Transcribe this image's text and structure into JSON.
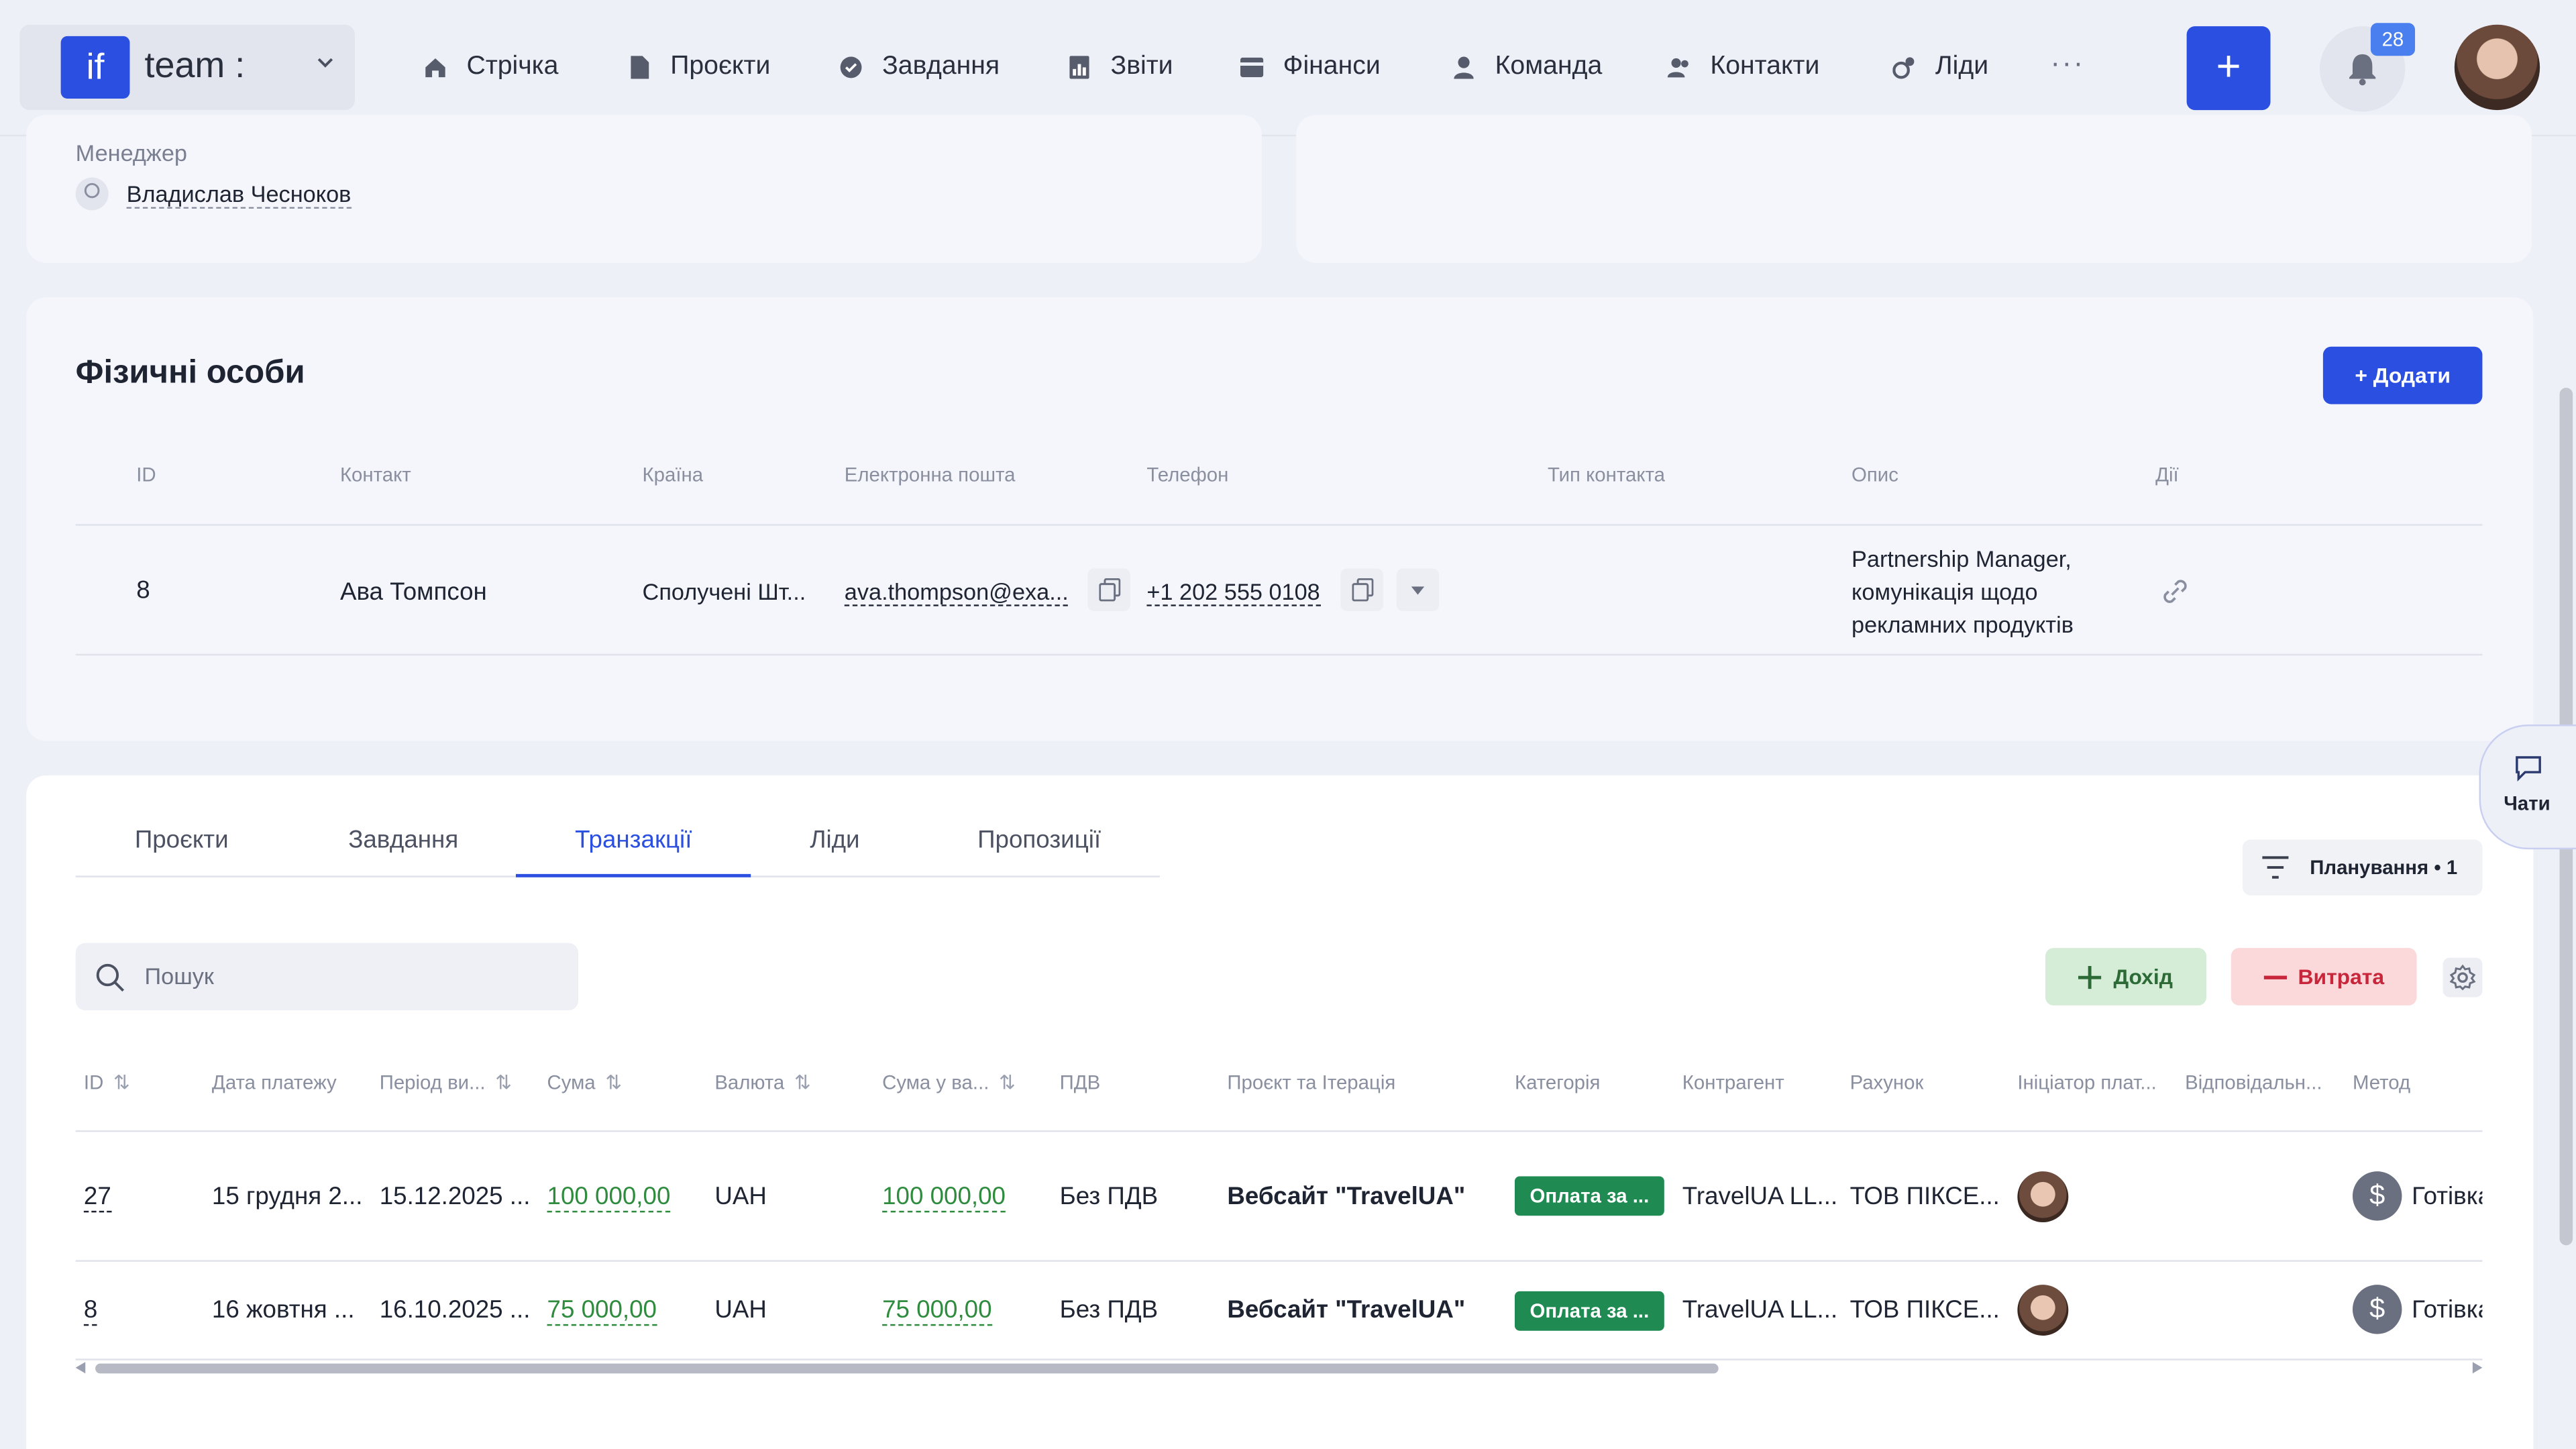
{
  "navbar": {
    "brand_logo": "if",
    "brand_name": "team :",
    "items": [
      {
        "label": "Стрічка",
        "icon": "home-icon"
      },
      {
        "label": "Проєкти",
        "icon": "document-icon"
      },
      {
        "label": "Завдання",
        "icon": "check-circle-icon"
      },
      {
        "label": "Звіти",
        "icon": "report-icon"
      },
      {
        "label": "Фінанси",
        "icon": "wallet-icon"
      },
      {
        "label": "Команда",
        "icon": "user-icon"
      },
      {
        "label": "Контакти",
        "icon": "contacts-icon"
      },
      {
        "label": "Ліди",
        "icon": "leads-icon"
      }
    ],
    "more": "···",
    "plus": "+",
    "notifications_count": "28"
  },
  "manager": {
    "label": "Менеджер",
    "name": "Владислав Чесноков"
  },
  "individuals": {
    "title": "Фізичні особи",
    "add_button": "+ Додати",
    "columns": [
      "ID",
      "Контакт",
      "Країна",
      "Електронна пошта",
      "Телефон",
      "Тип контакта",
      "Опис",
      "Дії"
    ],
    "row": {
      "id": "8",
      "contact": "Ава Томпсон",
      "country": "Сполучені Шт...",
      "email": "ava.thompson@exa...",
      "phone": "+1 202 555 0108",
      "description_lines": [
        "Partnership Manager,",
        "комунікація щодо",
        "рекламних продуктів"
      ]
    }
  },
  "tabs": [
    "Проєкти",
    "Завдання",
    "Транзакції",
    "Ліди",
    "Пропозиції"
  ],
  "active_tab": "Транзакції",
  "filter_label": "Планування • 1",
  "search_placeholder": "Пошук",
  "income_button": "Дохід",
  "expense_button": "Витрата",
  "transactions": {
    "columns": [
      "ID",
      "Дата платежу",
      "Період ви...",
      "Сума",
      "Валюта",
      "Сума у ва...",
      "ПДВ",
      "Проєкт та Ітерація",
      "Категорія",
      "Контрагент",
      "Рахунок",
      "Ініціатор плат...",
      "Відповідальн...",
      "Метод"
    ],
    "rows": [
      {
        "id": "27",
        "date": "15 грудня 2...",
        "period": "15.12.2025 ...",
        "amount": "100 000,00",
        "currency": "UAH",
        "amount_in_currency": "100 000,00",
        "vat": "Без ПДВ",
        "project": "Вебсайт \"TravelUA\"",
        "category": "Оплата за ...",
        "counterparty": "TravelUA LL...",
        "account": "ТОВ ПІКСЕ...",
        "method": "Готівка"
      },
      {
        "id": "8",
        "date": "16 жовтня ...",
        "period": "16.10.2025 ...",
        "amount": "75 000,00",
        "currency": "UAH",
        "amount_in_currency": "75 000,00",
        "vat": "Без ПДВ",
        "project": "Вебсайт \"TravelUA\"",
        "category": "Оплата за ...",
        "counterparty": "TravelUA LL...",
        "account": "ТОВ ПІКСЕ...",
        "method": "Готівка"
      }
    ]
  },
  "chat_label": "Чати",
  "colors": {
    "accent": "#2b4fe0",
    "income_bg": "#d5ecd6",
    "expense_bg": "#fbd8da",
    "category_badge": "#1f8a52",
    "amount_green": "#2f8b3d"
  }
}
